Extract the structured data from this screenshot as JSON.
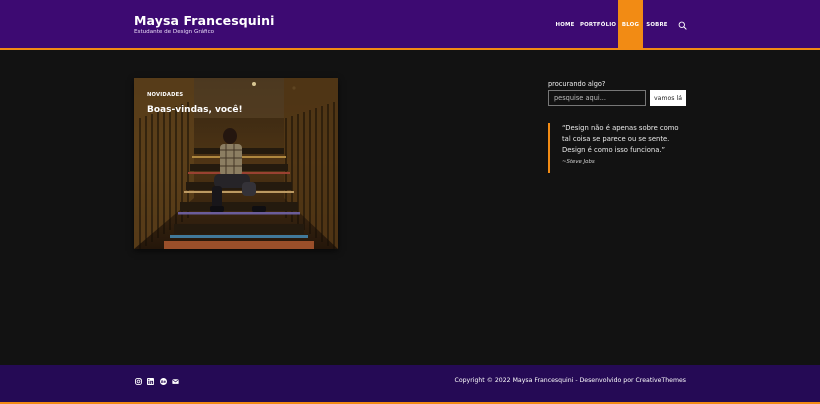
{
  "site": {
    "title": "Maysa Francesquini",
    "tagline": "Estudante de Design Gráfico"
  },
  "nav": {
    "items": [
      {
        "label": "HOME"
      },
      {
        "label": "PORTFÓLIO"
      },
      {
        "label": "BLOG"
      },
      {
        "label": "SOBRE"
      }
    ],
    "active": "BLOG",
    "search_icon": "search-icon"
  },
  "post": {
    "category": "NOVIDADES",
    "title": "Boas-vindas, você!"
  },
  "sidebar": {
    "search": {
      "label": "procurando algo?",
      "placeholder": "pesquise aqui...",
      "button_label": "vamos lá"
    },
    "quote": {
      "text": "“Design não é apenas sobre como tal coisa se parece ou se sente. Design é como isso funciona.”",
      "author": "~Steve Jobs"
    }
  },
  "footer": {
    "social_icons": [
      "instagram-icon",
      "linkedin-icon",
      "behance-icon",
      "email-icon"
    ],
    "copyright": "Copyright © 2022 Maysa Francesquini - Desenvolvido por CreativeThemes"
  },
  "colors": {
    "header_bg": "#3d0a72",
    "accent": "#f28b14",
    "page_bg": "#121212",
    "footer_bg": "#250a55"
  }
}
